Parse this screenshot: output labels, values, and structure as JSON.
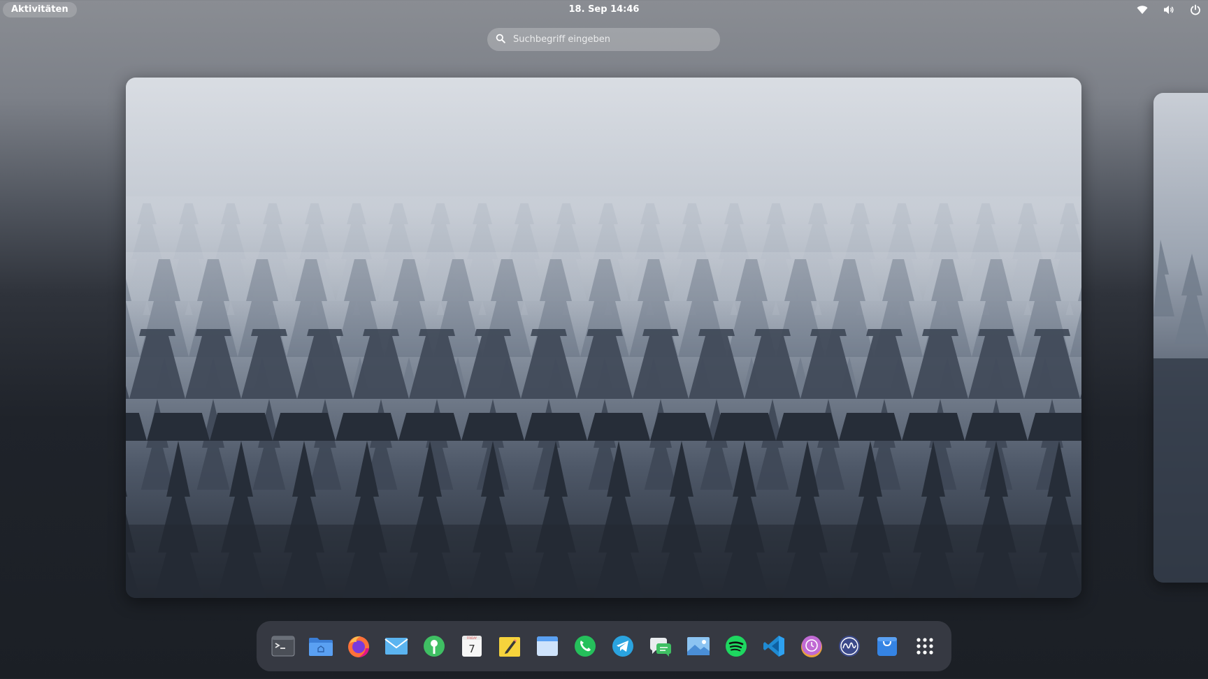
{
  "topbar": {
    "activities_label": "Aktivitäten",
    "clock": "18. Sep  14:46",
    "tray": [
      "wifi-icon",
      "volume-icon",
      "power-icon"
    ]
  },
  "search": {
    "placeholder": "Suchbegriff eingeben",
    "value": ""
  },
  "workspaces": [
    {
      "name": "workspace-1",
      "active": true
    },
    {
      "name": "workspace-2",
      "active": false
    }
  ],
  "dock": {
    "apps": [
      {
        "name": "terminal",
        "icon": "terminal-icon"
      },
      {
        "name": "files",
        "icon": "folder-icon"
      },
      {
        "name": "firefox",
        "icon": "firefox-icon"
      },
      {
        "name": "mail",
        "icon": "mail-icon"
      },
      {
        "name": "maps",
        "icon": "map-pin-icon"
      },
      {
        "name": "calendar",
        "icon": "calendar-icon",
        "day": "7",
        "weekday": "FRIDAY"
      },
      {
        "name": "notes",
        "icon": "notes-icon"
      },
      {
        "name": "window-app",
        "icon": "window-icon"
      },
      {
        "name": "whatsapp",
        "icon": "whatsapp-icon"
      },
      {
        "name": "telegram",
        "icon": "telegram-icon"
      },
      {
        "name": "messaging",
        "icon": "chat-bubbles-icon"
      },
      {
        "name": "image-viewer",
        "icon": "image-icon"
      },
      {
        "name": "spotify",
        "icon": "spotify-icon"
      },
      {
        "name": "vscode",
        "icon": "vscode-icon"
      },
      {
        "name": "clock",
        "icon": "clock-icon"
      },
      {
        "name": "system-monitor",
        "icon": "activity-wave-icon"
      },
      {
        "name": "software-store",
        "icon": "shopping-bag-icon"
      },
      {
        "name": "show-apps",
        "icon": "app-grid-icon"
      }
    ]
  },
  "colors": {
    "topbar_text": "#ffffff",
    "dock_bg": "#383c44",
    "spotify_green": "#1ed760",
    "telegram_blue": "#2aa3df",
    "whatsapp_green": "#25c05b"
  }
}
